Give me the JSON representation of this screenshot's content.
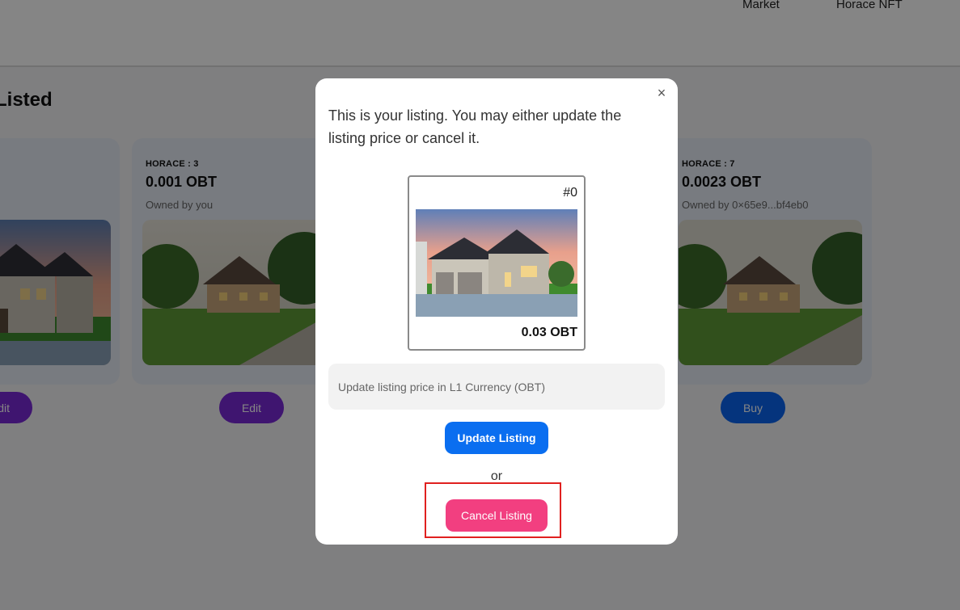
{
  "nav": {
    "items": [
      "Market",
      "Horace NFT"
    ]
  },
  "section": {
    "title": "Listed"
  },
  "cards": [
    {
      "collection": "",
      "price": "",
      "owner": "",
      "button_label": "Edit"
    },
    {
      "collection": "HORACE : 3",
      "price": "0.001 OBT",
      "owner": "Owned by you",
      "button_label": "Edit"
    },
    {
      "collection": "HORACE : 7",
      "price": "0.0023 OBT",
      "owner": "Owned by 0×65e9...bf4eb0",
      "button_label": "Buy"
    }
  ],
  "modal": {
    "message": "This is your listing. You may either update the listing price or cancel it.",
    "close_label": "×",
    "preview": {
      "token_id": "#0",
      "price": "0.03 OBT"
    },
    "price_input": {
      "placeholder": "Update listing price in L1 Currency (OBT)",
      "value": ""
    },
    "update_button": "Update Listing",
    "or_text": "or",
    "cancel_button": "Cancel Listing"
  },
  "colors": {
    "edit_button": "#7a2ad6",
    "buy_button": "#0a64f0",
    "update_button": "#0a6ef0",
    "cancel_button": "#f23f80",
    "highlight_box": "#e0201f",
    "card_bg": "#e6ecf6"
  }
}
